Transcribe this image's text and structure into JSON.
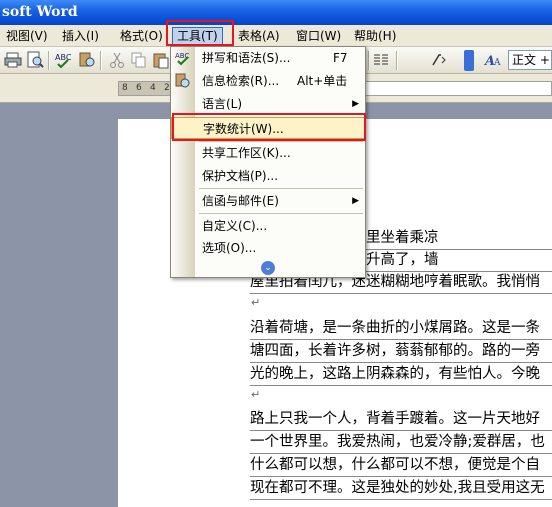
{
  "window": {
    "title": "soft Word"
  },
  "menubar": {
    "items": [
      {
        "label": "视图(V)"
      },
      {
        "label": "插入(I)"
      },
      {
        "label": "格式(O)"
      },
      {
        "label": "工具(T)"
      },
      {
        "label": "表格(A)"
      },
      {
        "label": "窗口(W)"
      },
      {
        "label": "帮助(H)"
      }
    ]
  },
  "toolbar": {
    "style_value": "正文 +"
  },
  "ruler": {
    "numbers": [
      "8",
      "6",
      "4",
      "2"
    ]
  },
  "tools_menu": {
    "items": [
      {
        "label": "拼写和语法(S)...",
        "shortcut": "F7"
      },
      {
        "label": "信息检索(R)...",
        "shortcut": "Alt+单击"
      },
      {
        "label": "语言(L)",
        "submenu": true
      },
      {
        "label": "字数统计(W)..."
      },
      {
        "label": "共享工作区(K)..."
      },
      {
        "label": "保护文档(P)..."
      },
      {
        "label": "信函与邮件(E)",
        "submenu": true
      },
      {
        "label": "自定义(C)..."
      },
      {
        "label": "选项(O)..."
      }
    ]
  },
  "document": {
    "lines": [
      "宁静。今晚在院子里坐着乘凉",
      "子吧。月亮渐渐地升高了，墙",
      "屋里拍着闰儿，迷迷糊糊地哼着眠歌。我悄悄",
      "沿着荷塘，是一条曲折的小煤屑路。这是一条",
      "塘四面，长着许多树，蓊蓊郁郁的。路的一旁",
      "光的晚上，这路上阴森森的，有些怕人。今晚",
      "路上只我一个人，背着手踱着。这一片天地好",
      "一个世界里。我爱热闹，也爱冷静;爱群居，也",
      "什么都可以想，什么都可以不想，便觉是个自",
      "现在都可不理。这是独处的妙处,我且受用这无"
    ]
  }
}
